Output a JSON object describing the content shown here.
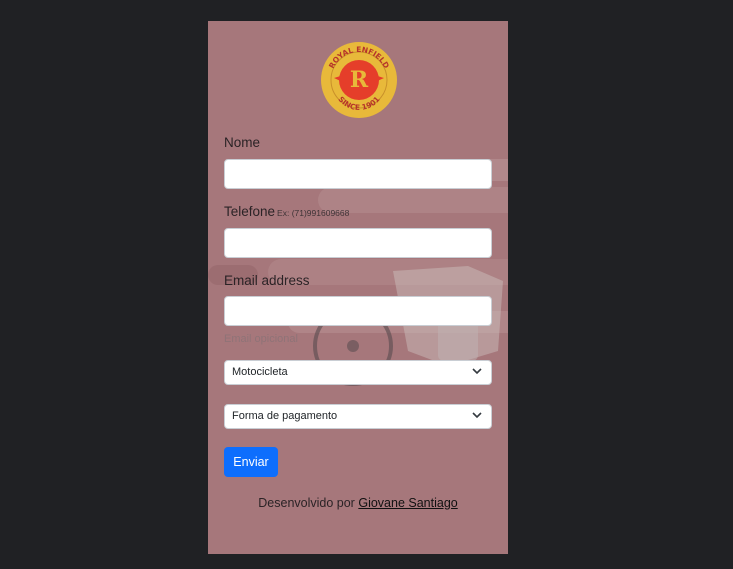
{
  "form": {
    "name_label": "Nome",
    "phone_label": "Telefone",
    "phone_hint": "Ex: (71)991609668",
    "email_label": "Email address",
    "email_help": "Email opicional",
    "name_value": "",
    "phone_value": "",
    "email_value": "",
    "motorcycle_select": "Motocicleta",
    "payment_select": "Forma de pagamento",
    "submit_label": "Enviar"
  },
  "footer": {
    "prefix": "Desenvolvido por",
    "author_link": "Giovane Santiago"
  },
  "logo": {
    "icon": "royal-enfield-logo",
    "top_text": "ROYAL ENFIELD",
    "bottom_text": "SINCE 1901",
    "colors": {
      "ring": "#e8b93a",
      "center": "#e53e2a"
    }
  },
  "colors": {
    "page_bg": "#202124",
    "card_bg": "#a6777b",
    "primary_button": "#0d6efd"
  }
}
